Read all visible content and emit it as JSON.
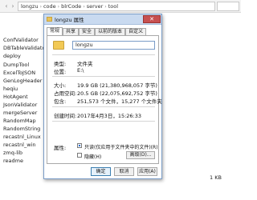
{
  "explorer": {
    "breadcrumbs": [
      "longzu",
      "code",
      "blrCode",
      "server",
      "tool"
    ],
    "folders": [
      "ConfValidator",
      "DBTableValidator",
      "deploy",
      "DumpTool",
      "ExcelToJSON",
      "GenLogHeader",
      "heqiu",
      "HotAgent",
      "JsonValidator",
      "mergeServer",
      "RandomMap",
      "RandomString",
      "recastnl_Linux",
      "recastnl_win",
      "zmq-lib",
      "readme"
    ],
    "readme_size": "1 KB"
  },
  "dialog": {
    "title": "longzu 属性",
    "close_glyph": "✕",
    "tabs": [
      "常规",
      "共享",
      "安全",
      "以前的版本",
      "自定义"
    ],
    "name_value": "longzu",
    "props": [
      {
        "label": "类型:",
        "value": "文件夹"
      },
      {
        "label": "位置:",
        "value": "E:\\"
      },
      {
        "label": "大小:",
        "value": "19.9 GB (21,380,968,057 字节)"
      },
      {
        "label": "占用空间:",
        "value": "20.5 GB (22,075,692,752 字节)"
      },
      {
        "label": "包含:",
        "value": "251,573 个文件，15,277 个文件夹"
      },
      {
        "label": "创建时间:",
        "value": "2017年4月3日，15:26:33"
      }
    ],
    "attributes_label": "属性:",
    "readonly_label": "只读(仅应用于文件夹中的文件)(R)",
    "hidden_label": "隐藏(H)",
    "advanced_label": "高级(D)...",
    "buttons": {
      "ok": "确定",
      "cancel": "取消",
      "apply": "应用(A)"
    }
  },
  "colors": {
    "accent": "#3c7fb1",
    "title_bar": "#c9daf0",
    "folder": "#f2c955"
  }
}
